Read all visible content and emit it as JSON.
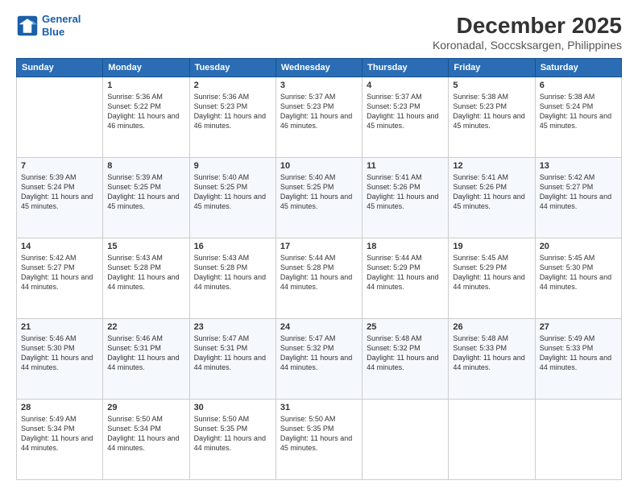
{
  "logo": {
    "line1": "General",
    "line2": "Blue"
  },
  "title": "December 2025",
  "subtitle": "Koronadal, Soccsksargen, Philippines",
  "days_of_week": [
    "Sunday",
    "Monday",
    "Tuesday",
    "Wednesday",
    "Thursday",
    "Friday",
    "Saturday"
  ],
  "weeks": [
    [
      {
        "day": "",
        "sunrise": "",
        "sunset": "",
        "daylight": ""
      },
      {
        "day": "1",
        "sunrise": "Sunrise: 5:36 AM",
        "sunset": "Sunset: 5:22 PM",
        "daylight": "Daylight: 11 hours and 46 minutes."
      },
      {
        "day": "2",
        "sunrise": "Sunrise: 5:36 AM",
        "sunset": "Sunset: 5:23 PM",
        "daylight": "Daylight: 11 hours and 46 minutes."
      },
      {
        "day": "3",
        "sunrise": "Sunrise: 5:37 AM",
        "sunset": "Sunset: 5:23 PM",
        "daylight": "Daylight: 11 hours and 46 minutes."
      },
      {
        "day": "4",
        "sunrise": "Sunrise: 5:37 AM",
        "sunset": "Sunset: 5:23 PM",
        "daylight": "Daylight: 11 hours and 45 minutes."
      },
      {
        "day": "5",
        "sunrise": "Sunrise: 5:38 AM",
        "sunset": "Sunset: 5:23 PM",
        "daylight": "Daylight: 11 hours and 45 minutes."
      },
      {
        "day": "6",
        "sunrise": "Sunrise: 5:38 AM",
        "sunset": "Sunset: 5:24 PM",
        "daylight": "Daylight: 11 hours and 45 minutes."
      }
    ],
    [
      {
        "day": "7",
        "sunrise": "Sunrise: 5:39 AM",
        "sunset": "Sunset: 5:24 PM",
        "daylight": "Daylight: 11 hours and 45 minutes."
      },
      {
        "day": "8",
        "sunrise": "Sunrise: 5:39 AM",
        "sunset": "Sunset: 5:25 PM",
        "daylight": "Daylight: 11 hours and 45 minutes."
      },
      {
        "day": "9",
        "sunrise": "Sunrise: 5:40 AM",
        "sunset": "Sunset: 5:25 PM",
        "daylight": "Daylight: 11 hours and 45 minutes."
      },
      {
        "day": "10",
        "sunrise": "Sunrise: 5:40 AM",
        "sunset": "Sunset: 5:25 PM",
        "daylight": "Daylight: 11 hours and 45 minutes."
      },
      {
        "day": "11",
        "sunrise": "Sunrise: 5:41 AM",
        "sunset": "Sunset: 5:26 PM",
        "daylight": "Daylight: 11 hours and 45 minutes."
      },
      {
        "day": "12",
        "sunrise": "Sunrise: 5:41 AM",
        "sunset": "Sunset: 5:26 PM",
        "daylight": "Daylight: 11 hours and 45 minutes."
      },
      {
        "day": "13",
        "sunrise": "Sunrise: 5:42 AM",
        "sunset": "Sunset: 5:27 PM",
        "daylight": "Daylight: 11 hours and 44 minutes."
      }
    ],
    [
      {
        "day": "14",
        "sunrise": "Sunrise: 5:42 AM",
        "sunset": "Sunset: 5:27 PM",
        "daylight": "Daylight: 11 hours and 44 minutes."
      },
      {
        "day": "15",
        "sunrise": "Sunrise: 5:43 AM",
        "sunset": "Sunset: 5:28 PM",
        "daylight": "Daylight: 11 hours and 44 minutes."
      },
      {
        "day": "16",
        "sunrise": "Sunrise: 5:43 AM",
        "sunset": "Sunset: 5:28 PM",
        "daylight": "Daylight: 11 hours and 44 minutes."
      },
      {
        "day": "17",
        "sunrise": "Sunrise: 5:44 AM",
        "sunset": "Sunset: 5:28 PM",
        "daylight": "Daylight: 11 hours and 44 minutes."
      },
      {
        "day": "18",
        "sunrise": "Sunrise: 5:44 AM",
        "sunset": "Sunset: 5:29 PM",
        "daylight": "Daylight: 11 hours and 44 minutes."
      },
      {
        "day": "19",
        "sunrise": "Sunrise: 5:45 AM",
        "sunset": "Sunset: 5:29 PM",
        "daylight": "Daylight: 11 hours and 44 minutes."
      },
      {
        "day": "20",
        "sunrise": "Sunrise: 5:45 AM",
        "sunset": "Sunset: 5:30 PM",
        "daylight": "Daylight: 11 hours and 44 minutes."
      }
    ],
    [
      {
        "day": "21",
        "sunrise": "Sunrise: 5:46 AM",
        "sunset": "Sunset: 5:30 PM",
        "daylight": "Daylight: 11 hours and 44 minutes."
      },
      {
        "day": "22",
        "sunrise": "Sunrise: 5:46 AM",
        "sunset": "Sunset: 5:31 PM",
        "daylight": "Daylight: 11 hours and 44 minutes."
      },
      {
        "day": "23",
        "sunrise": "Sunrise: 5:47 AM",
        "sunset": "Sunset: 5:31 PM",
        "daylight": "Daylight: 11 hours and 44 minutes."
      },
      {
        "day": "24",
        "sunrise": "Sunrise: 5:47 AM",
        "sunset": "Sunset: 5:32 PM",
        "daylight": "Daylight: 11 hours and 44 minutes."
      },
      {
        "day": "25",
        "sunrise": "Sunrise: 5:48 AM",
        "sunset": "Sunset: 5:32 PM",
        "daylight": "Daylight: 11 hours and 44 minutes."
      },
      {
        "day": "26",
        "sunrise": "Sunrise: 5:48 AM",
        "sunset": "Sunset: 5:33 PM",
        "daylight": "Daylight: 11 hours and 44 minutes."
      },
      {
        "day": "27",
        "sunrise": "Sunrise: 5:49 AM",
        "sunset": "Sunset: 5:33 PM",
        "daylight": "Daylight: 11 hours and 44 minutes."
      }
    ],
    [
      {
        "day": "28",
        "sunrise": "Sunrise: 5:49 AM",
        "sunset": "Sunset: 5:34 PM",
        "daylight": "Daylight: 11 hours and 44 minutes."
      },
      {
        "day": "29",
        "sunrise": "Sunrise: 5:50 AM",
        "sunset": "Sunset: 5:34 PM",
        "daylight": "Daylight: 11 hours and 44 minutes."
      },
      {
        "day": "30",
        "sunrise": "Sunrise: 5:50 AM",
        "sunset": "Sunset: 5:35 PM",
        "daylight": "Daylight: 11 hours and 44 minutes."
      },
      {
        "day": "31",
        "sunrise": "Sunrise: 5:50 AM",
        "sunset": "Sunset: 5:35 PM",
        "daylight": "Daylight: 11 hours and 45 minutes."
      },
      {
        "day": "",
        "sunrise": "",
        "sunset": "",
        "daylight": ""
      },
      {
        "day": "",
        "sunrise": "",
        "sunset": "",
        "daylight": ""
      },
      {
        "day": "",
        "sunrise": "",
        "sunset": "",
        "daylight": ""
      }
    ]
  ]
}
